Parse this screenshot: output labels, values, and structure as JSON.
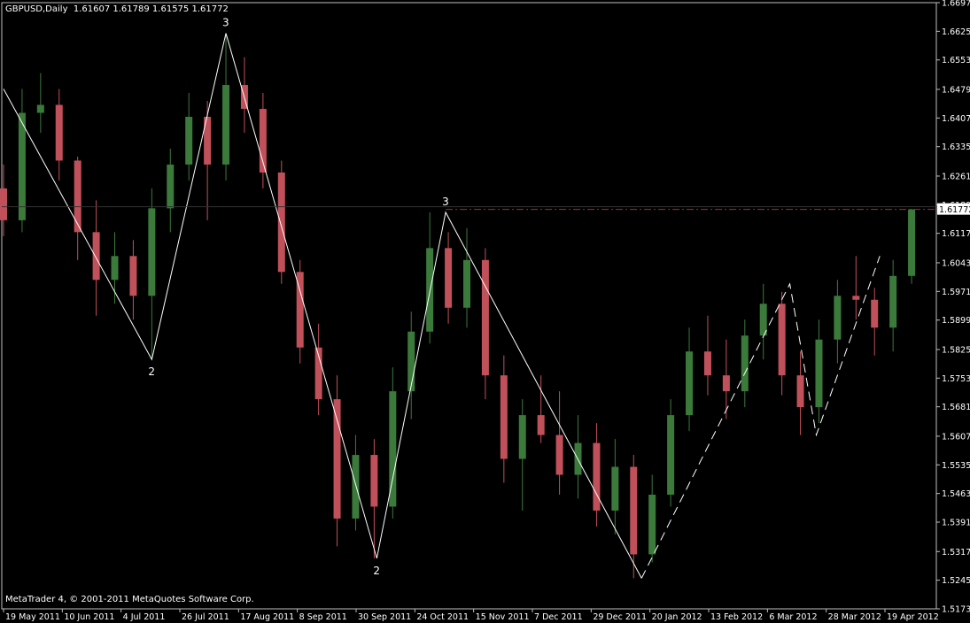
{
  "header": {
    "symbol": "GBPUSD,Daily",
    "ohlc": "1.61607 1.61789 1.61575 1.61772"
  },
  "copyright": "MetaTrader 4, © 2001-2011 MetaQuotes Software Corp.",
  "colors": {
    "background": "#000000",
    "axis": "#c0c0c0",
    "bull": "#3b7a3b",
    "bear": "#c0505a",
    "wave": "#ffffff",
    "price_line": "#a03030"
  },
  "chart_data": {
    "type": "candlestick",
    "price_range": [
      1.5173,
      1.6697
    ],
    "current_price": "1.61772",
    "y_ticks": [
      "1.66970",
      "1.66250",
      "1.65530",
      "1.64790",
      "1.64070",
      "1.63350",
      "1.62610",
      "1.61890",
      "1.61170",
      "1.60430",
      "1.59710",
      "1.58990",
      "1.58250",
      "1.57530",
      "1.56810",
      "1.56070",
      "1.55350",
      "1.54630",
      "1.53910",
      "1.53170",
      "1.52450",
      "1.51730"
    ],
    "x_ticks": [
      "19 May 2011",
      "10 Jun 2011",
      "4 Jul 2011",
      "26 Jul 2011",
      "17 Aug 2011",
      "8 Sep 2011",
      "30 Sep 2011",
      "24 Oct 2011",
      "15 Nov 2011",
      "7 Dec 2011",
      "29 Dec 2011",
      "20 Jan 2012",
      "13 Feb 2012",
      "6 Mar 2012",
      "28 Mar 2012",
      "19 Apr 2012"
    ],
    "wave_points": [
      {
        "date": "2011-05-17",
        "price": 1.648,
        "label": ""
      },
      {
        "date": "2011-07-12",
        "price": 1.58,
        "label": "2"
      },
      {
        "date": "2011-08-09",
        "price": 1.662,
        "label": "3"
      },
      {
        "date": "2011-10-05",
        "price": 1.53,
        "label": "2"
      },
      {
        "date": "2011-10-31",
        "price": 1.617,
        "label": "3"
      },
      {
        "date": "2012-01-13",
        "price": 1.525,
        "label": ""
      }
    ],
    "dashed_wave_points": [
      {
        "date": "2012-01-13",
        "price": 1.525
      },
      {
        "date": "2012-03-09",
        "price": 1.599
      },
      {
        "date": "2012-03-19",
        "price": 1.561
      },
      {
        "date": "2012-04-12",
        "price": 1.606
      }
    ],
    "price_line_start": "2011-10-31",
    "candles": [
      {
        "date": "2011-05-17",
        "o": 1.623,
        "h": 1.629,
        "l": 1.611,
        "c": 1.615
      },
      {
        "date": "2011-05-24",
        "o": 1.615,
        "h": 1.648,
        "l": 1.612,
        "c": 1.642
      },
      {
        "date": "2011-05-31",
        "o": 1.642,
        "h": 1.652,
        "l": 1.637,
        "c": 1.644
      },
      {
        "date": "2011-06-07",
        "o": 1.644,
        "h": 1.648,
        "l": 1.625,
        "c": 1.63
      },
      {
        "date": "2011-06-14",
        "o": 1.63,
        "h": 1.631,
        "l": 1.605,
        "c": 1.612
      },
      {
        "date": "2011-06-21",
        "o": 1.612,
        "h": 1.62,
        "l": 1.591,
        "c": 1.6
      },
      {
        "date": "2011-06-28",
        "o": 1.6,
        "h": 1.612,
        "l": 1.594,
        "c": 1.606
      },
      {
        "date": "2011-07-05",
        "o": 1.606,
        "h": 1.61,
        "l": 1.59,
        "c": 1.596
      },
      {
        "date": "2011-07-12",
        "o": 1.596,
        "h": 1.623,
        "l": 1.58,
        "c": 1.618
      },
      {
        "date": "2011-07-19",
        "o": 1.618,
        "h": 1.633,
        "l": 1.612,
        "c": 1.629
      },
      {
        "date": "2011-07-26",
        "o": 1.629,
        "h": 1.647,
        "l": 1.625,
        "c": 1.641
      },
      {
        "date": "2011-08-02",
        "o": 1.641,
        "h": 1.645,
        "l": 1.615,
        "c": 1.629
      },
      {
        "date": "2011-08-09",
        "o": 1.629,
        "h": 1.662,
        "l": 1.625,
        "c": 1.649
      },
      {
        "date": "2011-08-16",
        "o": 1.649,
        "h": 1.656,
        "l": 1.637,
        "c": 1.643
      },
      {
        "date": "2011-08-23",
        "o": 1.643,
        "h": 1.647,
        "l": 1.623,
        "c": 1.627
      },
      {
        "date": "2011-08-30",
        "o": 1.627,
        "h": 1.63,
        "l": 1.599,
        "c": 1.602
      },
      {
        "date": "2011-09-06",
        "o": 1.602,
        "h": 1.605,
        "l": 1.579,
        "c": 1.583
      },
      {
        "date": "2011-09-13",
        "o": 1.583,
        "h": 1.589,
        "l": 1.566,
        "c": 1.57
      },
      {
        "date": "2011-09-20",
        "o": 1.57,
        "h": 1.576,
        "l": 1.533,
        "c": 1.54
      },
      {
        "date": "2011-09-27",
        "o": 1.54,
        "h": 1.561,
        "l": 1.537,
        "c": 1.556
      },
      {
        "date": "2011-10-04",
        "o": 1.556,
        "h": 1.56,
        "l": 1.53,
        "c": 1.543
      },
      {
        "date": "2011-10-11",
        "o": 1.543,
        "h": 1.578,
        "l": 1.54,
        "c": 1.572
      },
      {
        "date": "2011-10-18",
        "o": 1.572,
        "h": 1.592,
        "l": 1.565,
        "c": 1.587
      },
      {
        "date": "2011-10-25",
        "o": 1.587,
        "h": 1.617,
        "l": 1.584,
        "c": 1.608
      },
      {
        "date": "2011-11-01",
        "o": 1.608,
        "h": 1.612,
        "l": 1.589,
        "c": 1.593
      },
      {
        "date": "2011-11-08",
        "o": 1.593,
        "h": 1.613,
        "l": 1.588,
        "c": 1.605
      },
      {
        "date": "2011-11-15",
        "o": 1.605,
        "h": 1.608,
        "l": 1.57,
        "c": 1.576
      },
      {
        "date": "2011-11-22",
        "o": 1.576,
        "h": 1.581,
        "l": 1.549,
        "c": 1.555
      },
      {
        "date": "2011-11-29",
        "o": 1.555,
        "h": 1.57,
        "l": 1.542,
        "c": 1.566
      },
      {
        "date": "2011-12-06",
        "o": 1.566,
        "h": 1.576,
        "l": 1.559,
        "c": 1.561
      },
      {
        "date": "2011-12-13",
        "o": 1.561,
        "h": 1.572,
        "l": 1.546,
        "c": 1.551
      },
      {
        "date": "2011-12-20",
        "o": 1.551,
        "h": 1.566,
        "l": 1.545,
        "c": 1.559
      },
      {
        "date": "2011-12-27",
        "o": 1.559,
        "h": 1.564,
        "l": 1.538,
        "c": 1.542
      },
      {
        "date": "2012-01-03",
        "o": 1.542,
        "h": 1.56,
        "l": 1.536,
        "c": 1.553
      },
      {
        "date": "2012-01-10",
        "o": 1.553,
        "h": 1.556,
        "l": 1.525,
        "c": 1.531
      },
      {
        "date": "2012-01-17",
        "o": 1.531,
        "h": 1.551,
        "l": 1.529,
        "c": 1.546
      },
      {
        "date": "2012-01-24",
        "o": 1.546,
        "h": 1.57,
        "l": 1.543,
        "c": 1.566
      },
      {
        "date": "2012-01-31",
        "o": 1.566,
        "h": 1.588,
        "l": 1.562,
        "c": 1.582
      },
      {
        "date": "2012-02-07",
        "o": 1.582,
        "h": 1.591,
        "l": 1.571,
        "c": 1.576
      },
      {
        "date": "2012-02-14",
        "o": 1.576,
        "h": 1.585,
        "l": 1.565,
        "c": 1.572
      },
      {
        "date": "2012-02-21",
        "o": 1.572,
        "h": 1.59,
        "l": 1.568,
        "c": 1.586
      },
      {
        "date": "2012-02-28",
        "o": 1.586,
        "h": 1.599,
        "l": 1.58,
        "c": 1.594
      },
      {
        "date": "2012-03-06",
        "o": 1.594,
        "h": 1.597,
        "l": 1.571,
        "c": 1.576
      },
      {
        "date": "2012-03-13",
        "o": 1.576,
        "h": 1.582,
        "l": 1.561,
        "c": 1.568
      },
      {
        "date": "2012-03-20",
        "o": 1.568,
        "h": 1.59,
        "l": 1.564,
        "c": 1.585
      },
      {
        "date": "2012-03-27",
        "o": 1.585,
        "h": 1.6,
        "l": 1.579,
        "c": 1.596
      },
      {
        "date": "2012-04-03",
        "o": 1.596,
        "h": 1.606,
        "l": 1.59,
        "c": 1.595
      },
      {
        "date": "2012-04-10",
        "o": 1.595,
        "h": 1.598,
        "l": 1.581,
        "c": 1.588
      },
      {
        "date": "2012-04-17",
        "o": 1.588,
        "h": 1.605,
        "l": 1.582,
        "c": 1.601
      },
      {
        "date": "2012-04-24",
        "o": 1.601,
        "h": 1.6179,
        "l": 1.599,
        "c": 1.6177
      }
    ]
  }
}
